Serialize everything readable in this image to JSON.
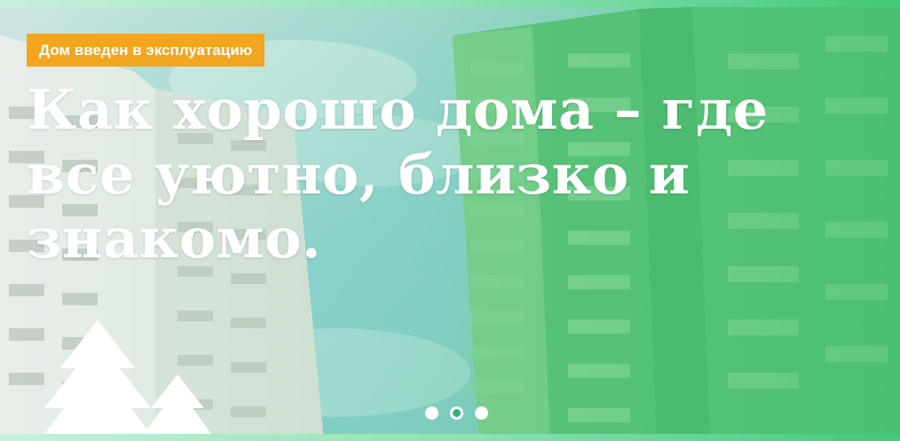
{
  "hero": {
    "badge": "Дом введен в эксплуатацию",
    "headline": "Как хорошо дома – где все уютно, близко и знакомо."
  },
  "slider": {
    "slide_count": 3,
    "active_index": 1
  },
  "colors": {
    "badge_bg": "#f2a51f",
    "dot_active": "#2fb37b",
    "green_overlay": "#55c77f"
  },
  "icons": [
    "tree-icon"
  ]
}
